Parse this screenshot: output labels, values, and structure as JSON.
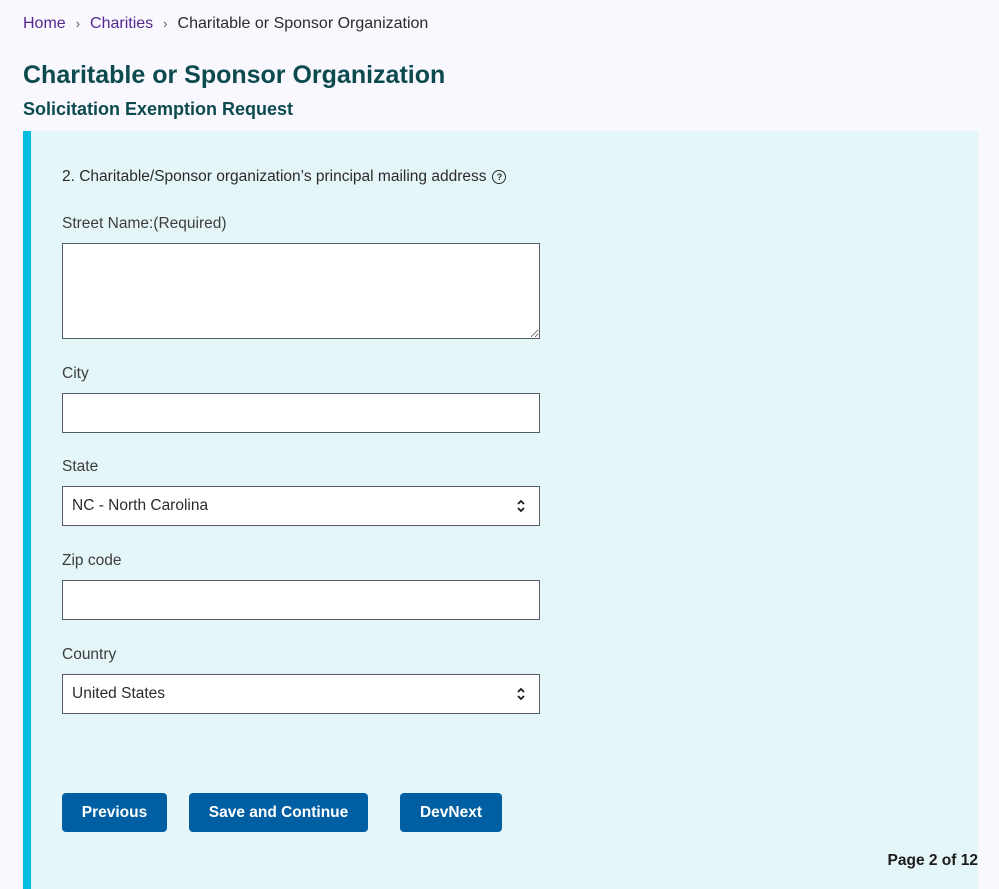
{
  "breadcrumb": {
    "items": [
      {
        "label": "Home"
      },
      {
        "label": "Charities"
      },
      {
        "label": "Charitable or Sponsor Organization"
      }
    ],
    "separator": "›"
  },
  "header": {
    "title": "Charitable or Sponsor Organization",
    "subtitle": "Solicitation Exemption Request"
  },
  "form": {
    "question": "2. Charitable/Sponsor organization’s principal mailing address",
    "help_icon": "question-circle-icon",
    "fields": {
      "street": {
        "label": "Street Name:(Required)",
        "value": "",
        "placeholder": ""
      },
      "city": {
        "label": "City",
        "value": "",
        "placeholder": ""
      },
      "state": {
        "label": "State",
        "selected": "NC - North Carolina"
      },
      "zip": {
        "label": "Zip code",
        "value": "",
        "placeholder": ""
      },
      "country": {
        "label": "Country",
        "selected": "United States"
      }
    }
  },
  "buttons": {
    "previous": "Previous",
    "save_continue": "Save and Continue",
    "dev_next": "DevNext"
  },
  "pagination": {
    "text": "Page 2 of 12",
    "current": 2,
    "total": 12
  },
  "colors": {
    "accent_border": "#00bde3",
    "panel_bg": "#e5f6f8",
    "button_bg": "#005ea2",
    "heading": "#0c4a4f",
    "link": "#54278f"
  }
}
